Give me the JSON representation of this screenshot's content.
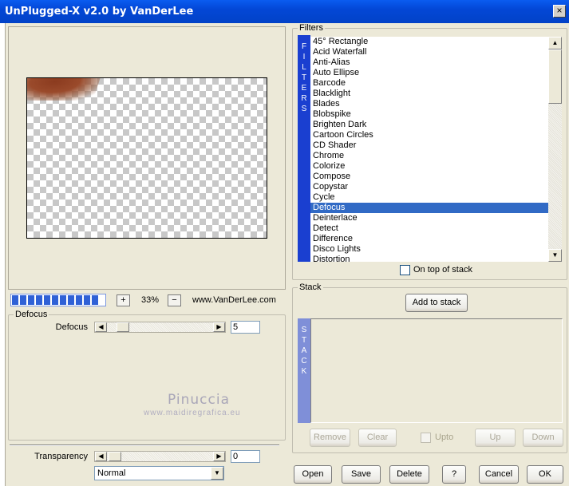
{
  "window": {
    "title": "UnPlugged-X v2.0 by VanDerLee",
    "close_glyph": "×"
  },
  "preview": {
    "progress_segments": 11,
    "zoom_in": "+",
    "zoom_out": "−",
    "zoom_value": "33%",
    "url": "www.VanDerLee.com"
  },
  "filter_group": {
    "title": "Defocus",
    "param_label": "Defocus",
    "param_value": "5"
  },
  "watermark": {
    "line1": "Pinuccia",
    "line2": "www.maidiregrafica.eu"
  },
  "transparency": {
    "label": "Transparency",
    "value": "0",
    "blend_mode": "Normal"
  },
  "filters": {
    "group_title": "Filters",
    "tab_letters": [
      "F",
      "I",
      "L",
      "T",
      "E",
      "R",
      "S"
    ],
    "items": [
      "45° Rectangle",
      "Acid Waterfall",
      "Anti-Alias",
      "Auto Ellipse",
      "Barcode",
      "Blacklight",
      "Blades",
      "Blobspike",
      "Brighten Dark",
      "Cartoon Circles",
      "CD Shader",
      "Chrome",
      "Colorize",
      "Compose",
      "Copystar",
      "Cycle",
      "Defocus",
      "Deinterlace",
      "Detect",
      "Difference",
      "Disco Lights",
      "Distortion"
    ],
    "selected": "Defocus",
    "on_top_label": "On top of stack"
  },
  "stack": {
    "group_title": "Stack",
    "add_label": "Add to stack",
    "tab_letters": [
      "S",
      "T",
      "A",
      "C",
      "K"
    ],
    "remove_label": "Remove",
    "clear_label": "Clear",
    "upto_label": "Upto",
    "up_label": "Up",
    "down_label": "Down"
  },
  "footer": {
    "open": "Open",
    "save": "Save",
    "delete": "Delete",
    "help": "?",
    "cancel": "Cancel",
    "ok": "OK"
  }
}
